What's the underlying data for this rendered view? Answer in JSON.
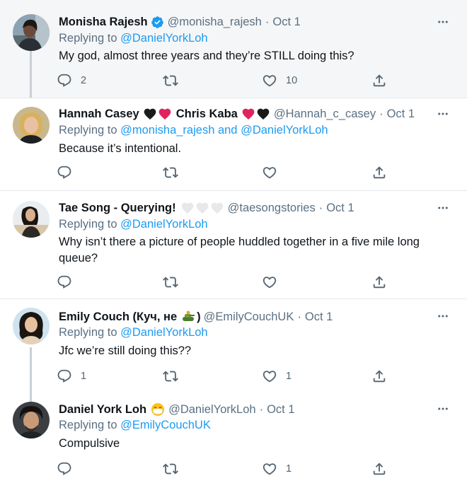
{
  "tweets": [
    {
      "name": "Monisha Rajesh",
      "handle": "@monisha_rajesh",
      "separator": "·",
      "time": "Oct 1",
      "replying_prefix": "Replying to ",
      "replying_to": "@DanielYorkLoh",
      "text": "My god, almost three years and they’re STILL doing this?",
      "reply_count": "2",
      "retweet_count": "",
      "like_count": "10",
      "verified": true
    },
    {
      "name_part1": "Hannah Casey",
      "name_part2": "Chris Kaba",
      "handle": "@Hannah_c_casey",
      "separator": "·",
      "time": "Oct 1",
      "replying_prefix": "Replying to ",
      "replying_to_1": "@monisha_rajesh",
      "replying_and": " and ",
      "replying_to_2": "@DanielYorkLoh",
      "text": "Because it’s intentional.",
      "reply_count": "",
      "retweet_count": "",
      "like_count": ""
    },
    {
      "name": "Tae Song - Querying!",
      "handle": "@taesongstories",
      "separator": "·",
      "time": "Oct 1",
      "replying_prefix": "Replying to ",
      "replying_to": "@DanielYorkLoh",
      "text": "Why isn’t there a picture of people huddled together in a five mile long queue?",
      "reply_count": "",
      "retweet_count": "",
      "like_count": ""
    },
    {
      "name_part1": "Emily Couch (Куч, не",
      "name_part2": ")",
      "handle": "@EmilyCouchUK",
      "separator": "·",
      "time": "Oct 1",
      "replying_prefix": "Replying to ",
      "replying_to": "@DanielYorkLoh",
      "text": "Jfc we’re still doing this??",
      "reply_count": "1",
      "retweet_count": "",
      "like_count": "1"
    },
    {
      "name": "Daniel York Loh",
      "handle": "@DanielYorkLoh",
      "separator": "·",
      "time": "Oct 1",
      "replying_prefix": "Replying to ",
      "replying_to": "@EmilyCouchUK",
      "text": "Compulsive",
      "reply_count": "",
      "retweet_count": "",
      "like_count": "1"
    }
  ],
  "colors": {
    "link": "#1d9bf0",
    "secondary_text": "#5b7083",
    "verified": "#1d9bf0",
    "heart_red": "#e0245e",
    "heart_black": "#1a1a1a",
    "highlight_bg": "#f5f6f7"
  },
  "icons": {
    "reply": "reply-icon",
    "retweet": "retweet-icon",
    "like": "like-icon",
    "share": "share-icon",
    "more": "more-options-icon",
    "verified": "verified-badge-icon"
  }
}
